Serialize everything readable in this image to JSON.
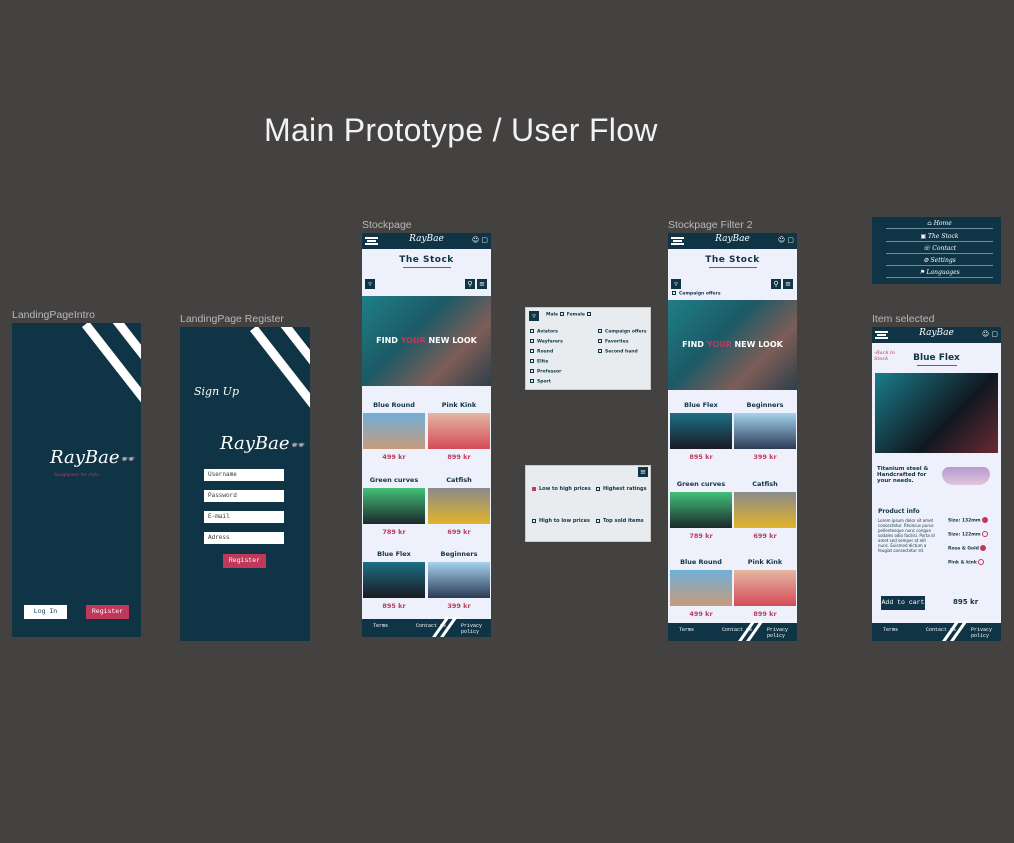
{
  "heading": "Main Prototype / User Flow",
  "frames": {
    "landing_intro": {
      "label": "LandingPageIntro",
      "logo": "RayBae",
      "tagline": "Sunglasses for style",
      "login": "Log In",
      "register": "Register"
    },
    "landing_register": {
      "label": "LandingPage Register",
      "title": "Sign Up",
      "logo": "RayBae",
      "fields": [
        "Username",
        "Password",
        "E-mail",
        "Adress"
      ],
      "register": "Register"
    },
    "stockpage": {
      "label": "Stockpage",
      "logo": "RayBae",
      "title": "The Stock",
      "hero": {
        "part1": "FIND ",
        "accent": "YOUR",
        "part2": " NEW LOOK"
      }
    },
    "stockpage_filter2": {
      "label": "Stockpage Filter 2",
      "logo": "RayBae",
      "title": "The Stock",
      "campaign": "Campaign offers",
      "hero": {
        "part1": "FIND ",
        "accent": "YOUR",
        "part2": " NEW LOOK"
      }
    },
    "menu": {
      "items": [
        "Home",
        "The Stock",
        "Contact",
        "Settings",
        "Languages"
      ]
    },
    "item_selected": {
      "label": "Item selected",
      "logo": "RayBae",
      "back": "Back to Stock",
      "title": "Blue Flex",
      "tagline": "Titanium steel & Handcrafted for your needs.",
      "info_title": "Product info",
      "info_text": "Lorem ipsum dolor sit amet consectetur. Rhoncus purus pellentesque nunc congue sodales odio facilisi. Porta id amet sed semper at elit nunc. Euismod dictum a feugiat consectetur sit.",
      "sizes": [
        "Size: 132mm",
        "Size: 122mm",
        "Rose & Gold",
        "Pink & kink"
      ],
      "add": "Add to cart",
      "price": "895 kr"
    }
  },
  "stock_products": [
    {
      "name": "Blue Round",
      "price": "499 kr"
    },
    {
      "name": "Pink Kink",
      "price": "899 kr"
    },
    {
      "name": "Green curves",
      "price": "789 kr"
    },
    {
      "name": "Catfish",
      "price": "699 kr"
    },
    {
      "name": "Blue Flex",
      "price": "895 kr"
    },
    {
      "name": "Beginners",
      "price": "399 kr"
    }
  ],
  "filter2_products": [
    {
      "name": "Blue Flex",
      "price": "895 kr"
    },
    {
      "name": "Beginners",
      "price": "399 kr"
    },
    {
      "name": "Green curves",
      "price": "789 kr"
    },
    {
      "name": "Catfish",
      "price": "699 kr"
    },
    {
      "name": "Blue Round",
      "price": "499 kr"
    },
    {
      "name": "Pink Kink",
      "price": "899 kr"
    }
  ],
  "filter_popup": {
    "gender": [
      "Male",
      "Female"
    ],
    "left": [
      "Aviators",
      "Wayfarers",
      "Round",
      "Elite",
      "Professor",
      "Sport"
    ],
    "right": [
      "Campaign offers",
      "Favorites",
      "Second hand"
    ]
  },
  "sort_popup": {
    "options": [
      "Low to high prices",
      "Highest ratings",
      "High to low prices",
      "Top sold items"
    ]
  },
  "footer": {
    "terms": "Terms",
    "contact": "Contact us",
    "privacy": "Privacy policy"
  },
  "colors": {
    "navy": "#0f3445",
    "accent": "#c0395a",
    "light": "#eef0fb"
  }
}
